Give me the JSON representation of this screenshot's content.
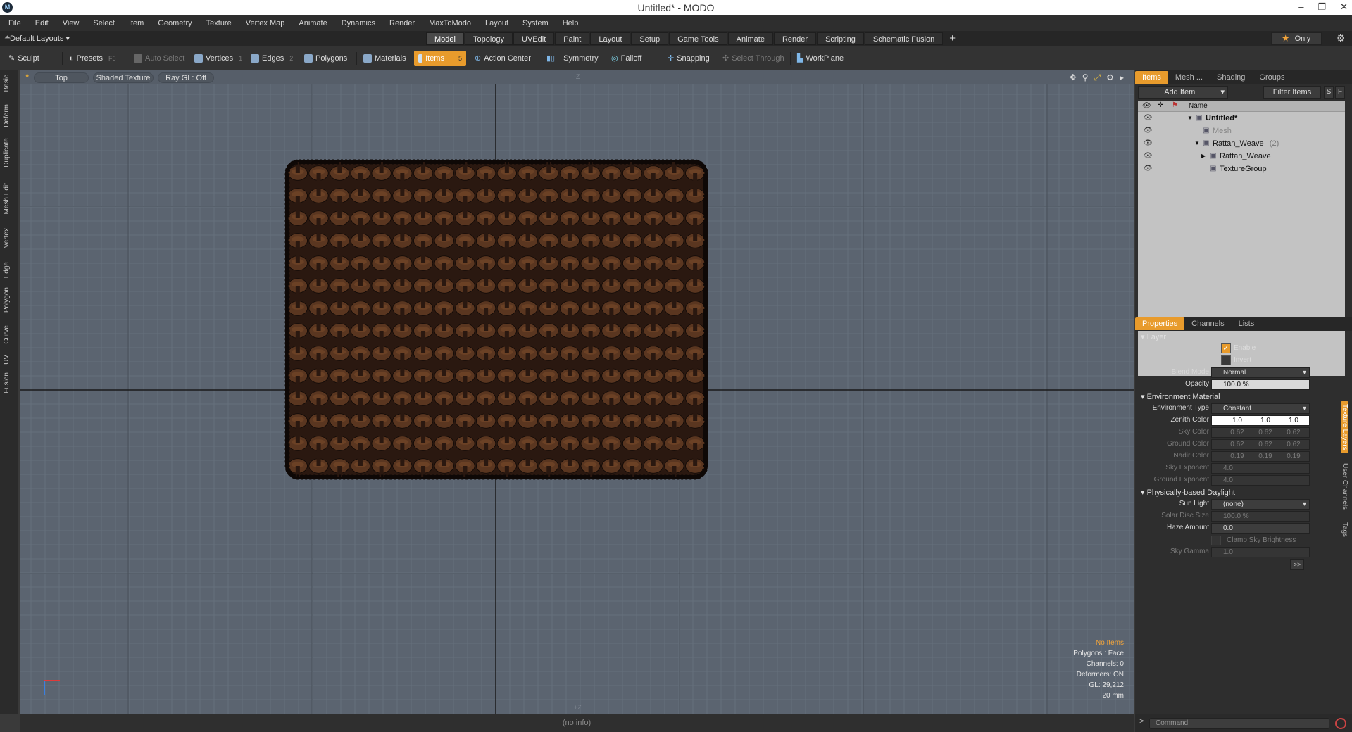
{
  "window": {
    "title": "Untitled* - MODO",
    "controls": [
      "–",
      "❐",
      "✕"
    ]
  },
  "menu": [
    "File",
    "Edit",
    "View",
    "Select",
    "Item",
    "Geometry",
    "Texture",
    "Vertex Map",
    "Animate",
    "Dynamics",
    "Render",
    "MaxToModo",
    "Layout",
    "System",
    "Help"
  ],
  "layout_bar": {
    "layout_name": "Default Layouts",
    "tabs": [
      "Model",
      "Topology",
      "UVEdit",
      "Paint",
      "Layout",
      "Setup",
      "Game Tools",
      "Animate",
      "Render",
      "Scripting",
      "Schematic Fusion"
    ],
    "active_tab": "Model",
    "only_label": "Only"
  },
  "toolbar": {
    "sculpt": "Sculpt",
    "presets": "Presets",
    "presets_key": "F6",
    "auto_select": "Auto Select",
    "vertices": "Vertices",
    "vertices_key": "1",
    "edges": "Edges",
    "edges_key": "2",
    "polygons": "Polygons",
    "materials": "Materials",
    "items": "Items",
    "items_key": "5",
    "action_center": "Action Center",
    "symmetry": "Symmetry",
    "falloff": "Falloff",
    "snapping": "Snapping",
    "select_through": "Select Through",
    "workplane": "WorkPlane"
  },
  "left_tabs": [
    "Basic",
    "Deform",
    "Duplicate",
    "Mesh Edit",
    "Vertex",
    "Edge",
    "Polygon",
    "Curve",
    "UV",
    "Fusion"
  ],
  "viewport": {
    "view": "Top",
    "shading": "Shaded Texture",
    "raygl": "Ray GL: Off",
    "axis_top": "-Z",
    "axis_bottom": "+Z",
    "status": {
      "no_items": "No Items",
      "polygons": "Polygons : Face",
      "channels": "Channels: 0",
      "deformers": "Deformers: ON",
      "gl": "GL: 29,212",
      "scale": "20 mm"
    },
    "footer": "(no info)",
    "mesh_colors": {
      "base": "#2a1810",
      "strand": "#5a3620",
      "highlight": "#7a4a2a",
      "edge": "#0e0806"
    }
  },
  "items_panel": {
    "tabs": [
      "Items",
      "Mesh ...",
      "Shading",
      "Groups"
    ],
    "active_tab": "Items",
    "add_item": "Add Item",
    "filter_items": "Filter Items",
    "btn_s": "S",
    "btn_f": "F",
    "name_col": "Name",
    "tree": [
      {
        "label": "Untitled*",
        "bold": true,
        "indent": 0,
        "arrow": "▼"
      },
      {
        "label": "Mesh",
        "dim": true,
        "indent": 1,
        "arrow": ""
      },
      {
        "label": "Rattan_Weave",
        "suffix": "(2)",
        "indent": 1,
        "arrow": "▼"
      },
      {
        "label": "Rattan_Weave",
        "indent": 2,
        "arrow": "▶"
      },
      {
        "label": "TextureGroup",
        "indent": 2,
        "arrow": ""
      }
    ]
  },
  "props_panel": {
    "tabs": [
      "Properties",
      "Channels",
      "Lists"
    ],
    "active_tab": "Properties",
    "side_tabs": [
      "Texture Layers",
      "User Channels",
      "Tags"
    ],
    "layer_section": "Layer",
    "enable": "Enable",
    "invert": "Invert",
    "blend_mode_label": "Blend Mode",
    "blend_mode": "Normal",
    "opacity_label": "Opacity",
    "opacity": "100.0 %",
    "env_section": "Environment Material",
    "env_type_label": "Environment Type",
    "env_type": "Constant",
    "zenith_label": "Zenith Color",
    "zenith": [
      "1.0",
      "1.0",
      "1.0"
    ],
    "sky_label": "Sky Color",
    "sky": [
      "0.62",
      "0.62",
      "0.62"
    ],
    "ground_label": "Ground Color",
    "ground": [
      "0.62",
      "0.62",
      "0.62"
    ],
    "nadir_label": "Nadir Color",
    "nadir": [
      "0.19",
      "0.19",
      "0.19"
    ],
    "sky_exp_label": "Sky Exponent",
    "sky_exp": "4.0",
    "ground_exp_label": "Ground Exponent",
    "ground_exp": "4.0",
    "daylight_section": "Physically-based Daylight",
    "sun_label": "Sun Light",
    "sun": "(none)",
    "solar_label": "Solar Disc Size",
    "solar": "100.0 %",
    "haze_label": "Haze Amount",
    "haze": "0.0",
    "clamp": "Clamp Sky Brightness",
    "gamma_label": "Sky Gamma",
    "gamma": "1.0",
    "more": ">>"
  },
  "command": {
    "placeholder": "Command",
    "prompt": ">"
  }
}
